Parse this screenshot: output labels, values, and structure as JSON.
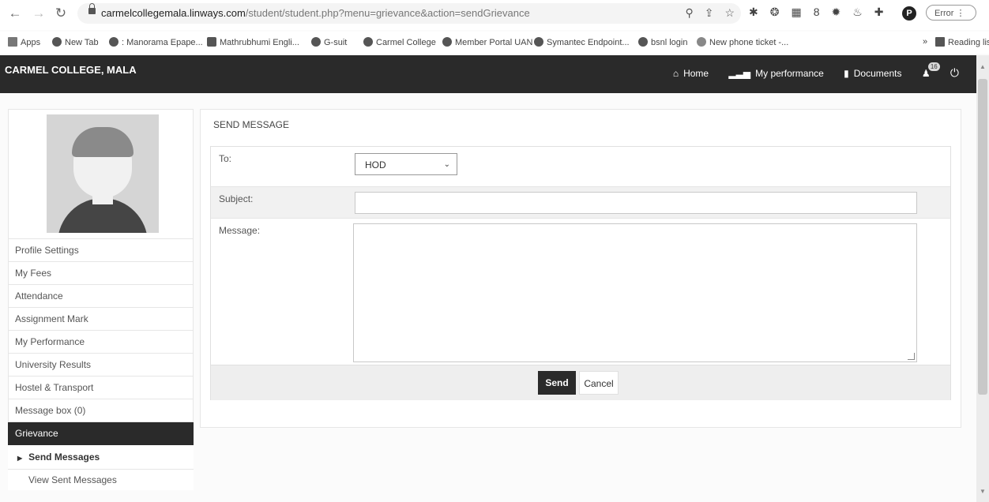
{
  "browser": {
    "url_host": "carmelcollegemala.linways.com",
    "url_path": "/student/student.php?menu=grievance&action=sendGrievance",
    "profile_initial": "P",
    "error_label": "Error",
    "bookmarks": [
      {
        "label": "Apps"
      },
      {
        "label": "New Tab"
      },
      {
        "label": ": Manorama Epape..."
      },
      {
        "label": "Mathrubhumi Engli..."
      },
      {
        "label": "G-suit"
      },
      {
        "label": "Carmel College"
      },
      {
        "label": "Member Portal UAN"
      },
      {
        "label": "Symantec Endpoint..."
      },
      {
        "label": "bsnl login"
      },
      {
        "label": "New phone ticket -..."
      },
      {
        "label": "»"
      },
      {
        "label": "Reading list"
      }
    ]
  },
  "site": {
    "title": "CARMEL COLLEGE, MALA",
    "nav": {
      "home": "Home",
      "performance": "My performance",
      "documents": "Documents",
      "notification_count": "16"
    }
  },
  "sidebar": {
    "items": [
      "Profile Settings",
      "My Fees",
      "Attendance",
      "Assignment Mark",
      "My Performance",
      "University Results",
      "Hostel & Transport",
      "Message box (0)",
      "Grievance"
    ],
    "sub_active": "Send Messages",
    "sub_other": "View Sent Messages"
  },
  "form": {
    "panel_title": "SEND MESSAGE",
    "to_label": "To:",
    "to_value": "HOD",
    "subject_label": "Subject:",
    "message_label": "Message:",
    "send_label": "Send",
    "cancel_label": "Cancel"
  }
}
